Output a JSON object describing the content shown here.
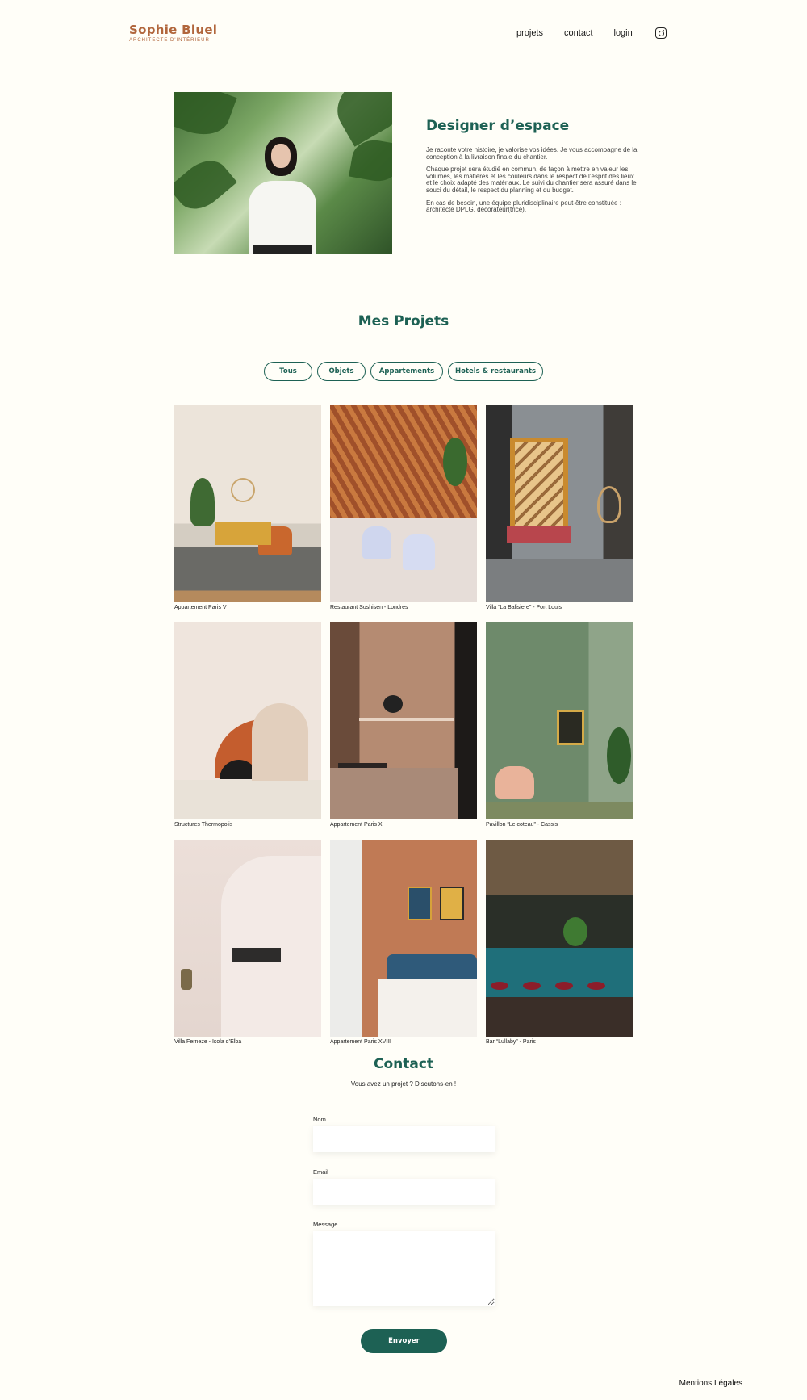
{
  "header": {
    "logo_title": "Sophie Bluel",
    "logo_subtitle": "ARCHITECTE D'INTÉRIEUR",
    "nav": [
      "projets",
      "contact",
      "login"
    ],
    "social_icon": "instagram-icon"
  },
  "intro": {
    "title": "Designer d’espace",
    "paragraphs": [
      "Je raconte votre histoire, je valorise vos idées. Je vous accompagne de la conception à la livraison finale du chantier.",
      "Chaque projet sera étudié en commun, de façon à mettre en valeur les volumes, les matières et les couleurs dans le respect de l’esprit des lieux et le choix adapté des matériaux. Le suivi du chantier sera assuré dans le souci du détail, le respect du planning et du budget.",
      "En cas de besoin, une équipe pluridisciplinaire peut-être constituée : architecte DPLG, décorateur(trice)."
    ]
  },
  "projects": {
    "title": "Mes Projets",
    "filters": [
      "Tous",
      "Objets",
      "Appartements",
      "Hotels & restaurants"
    ],
    "items": [
      "Appartement Paris V",
      "Restaurant Sushisen - Londres",
      "Villa “La Balisiere” - Port Louis",
      "Structures Thermopolis",
      "Appartement Paris X",
      "Pavillon “Le coteau” - Cassis",
      "Villa Ferneze - Isola d’Elba",
      "Appartement Paris XVIII",
      "Bar “Lullaby” - Paris"
    ]
  },
  "contact": {
    "title": "Contact",
    "subtitle": "Vous avez un projet ? Discutons-en !",
    "name_label": "Nom",
    "email_label": "Email",
    "message_label": "Message",
    "submit_label": "Envoyer"
  },
  "footer": {
    "legal": "Mentions Légales"
  },
  "colors": {
    "accent": "#1d6154",
    "logo": "#b1663c",
    "background": "#fffef8"
  }
}
